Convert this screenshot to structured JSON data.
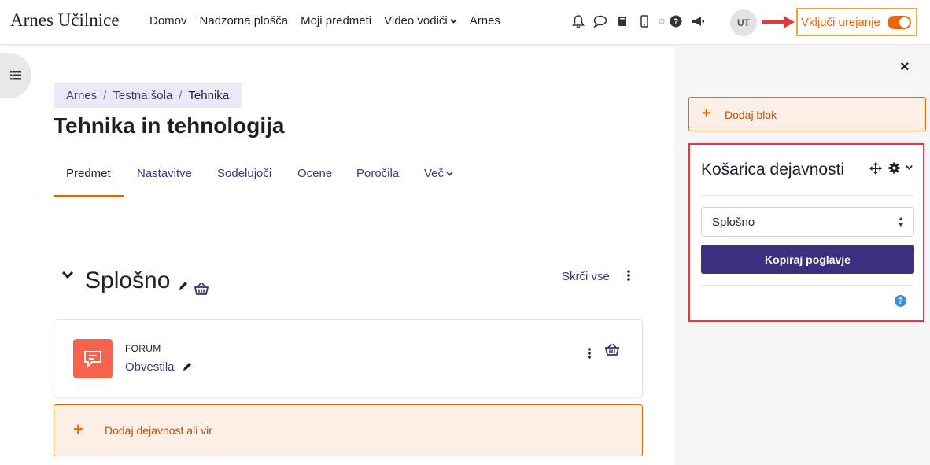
{
  "navbar": {
    "brand": "Arnes Učilnice",
    "links": [
      "Domov",
      "Nadzorna plošča",
      "Moji predmeti",
      "Video vodiči",
      "Arnes"
    ],
    "avatar_initials": "UT",
    "edit_mode_label": "Vključi urejanje",
    "edit_mode_on": true,
    "icons": [
      "bell-icon",
      "chat-icon",
      "book-icon",
      "mobile-icon",
      "hat-icon",
      "help-icon",
      "megaphone-icon"
    ]
  },
  "breadcrumb": [
    "Arnes",
    "Testna šola",
    "Tehnika"
  ],
  "page_title": "Tehnika in tehnologija",
  "tabs": [
    "Predmet",
    "Nastavitve",
    "Sodelujoči",
    "Ocene",
    "Poročila",
    "Več"
  ],
  "active_tab": "Predmet",
  "section": {
    "title": "Splošno",
    "collapse_label": "Skrči vse"
  },
  "activity": {
    "type": "FORUM",
    "name": "Obvestila"
  },
  "add_activity_label": "Dodaj dejavnost ali vir",
  "right_drawer": {
    "add_block_label": "Dodaj blok",
    "block_title": "Košarica dejavnosti",
    "select_value": "Splošno",
    "button_label": "Kopiraj poglavje"
  },
  "colors": {
    "accent_orange": "#e8660c",
    "primary_purple": "#3b2f7e",
    "highlight_red": "#e03a3a",
    "highlight_yellow": "#f0a82e",
    "forum_icon_bg": "#f7634d"
  }
}
